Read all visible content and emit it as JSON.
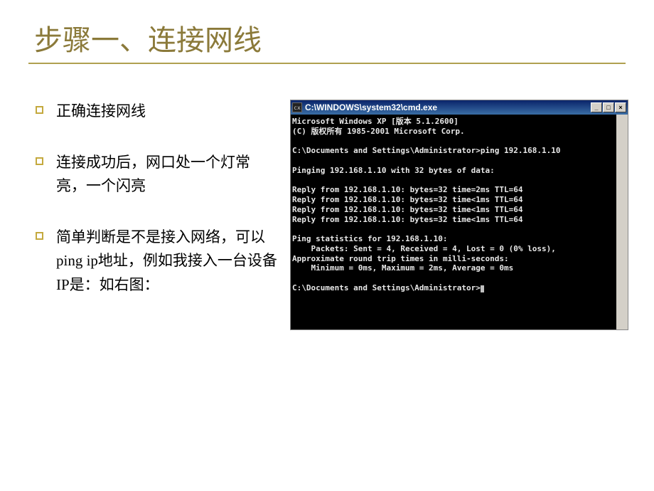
{
  "title": "步骤一、连接网线",
  "bullets": [
    "正确连接网线",
    "连接成功后，网口处一个灯常亮，一个闪亮",
    "简单判断是不是接入网络，可以ping ip地址，例如我接入一台设备IP是：如右图："
  ],
  "cmd": {
    "title": "C:\\WINDOWS\\system32\\cmd.exe",
    "icon_label": "cx",
    "lines": {
      "l0": "Microsoft Windows XP [版本 5.1.2600]",
      "l1": "(C) 版权所有 1985-2001 Microsoft Corp.",
      "l2": "",
      "l3": "C:\\Documents and Settings\\Administrator>ping 192.168.1.10",
      "l4": "",
      "l5": "Pinging 192.168.1.10 with 32 bytes of data:",
      "l6": "",
      "l7": "Reply from 192.168.1.10: bytes=32 time=2ms TTL=64",
      "l8": "Reply from 192.168.1.10: bytes=32 time<1ms TTL=64",
      "l9": "Reply from 192.168.1.10: bytes=32 time<1ms TTL=64",
      "l10": "Reply from 192.168.1.10: bytes=32 time<1ms TTL=64",
      "l11": "",
      "l12": "Ping statistics for 192.168.1.10:",
      "l13": "    Packets: Sent = 4, Received = 4, Lost = 0 (0% loss),",
      "l14": "Approximate round trip times in milli-seconds:",
      "l15": "    Minimum = 0ms, Maximum = 2ms, Average = 0ms",
      "l16": "",
      "l17": "C:\\Documents and Settings\\Administrator>"
    },
    "buttons": {
      "min": "_",
      "max": "□",
      "close": "×"
    }
  }
}
